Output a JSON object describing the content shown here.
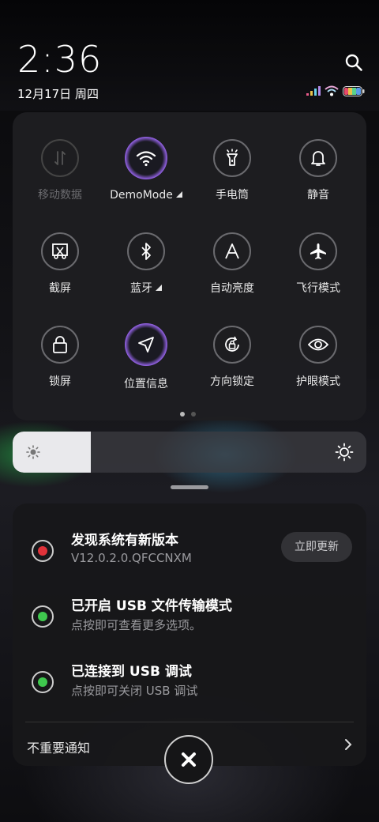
{
  "status": {
    "time": "2:36",
    "date": "12月17日 周四"
  },
  "quick_settings": {
    "tiles": [
      {
        "label": "移动数据",
        "icon": "mobile-data-icon",
        "state": "disabled"
      },
      {
        "label": "DemoMode",
        "icon": "wifi-icon",
        "state": "active",
        "has_menu": true
      },
      {
        "label": "手电筒",
        "icon": "flashlight-icon",
        "state": "off"
      },
      {
        "label": "静音",
        "icon": "bell-icon",
        "state": "off"
      },
      {
        "label": "截屏",
        "icon": "screenshot-icon",
        "state": "off"
      },
      {
        "label": "蓝牙",
        "icon": "bluetooth-icon",
        "state": "off",
        "has_menu": true
      },
      {
        "label": "自动亮度",
        "icon": "auto-brightness-icon",
        "state": "off"
      },
      {
        "label": "飞行模式",
        "icon": "airplane-icon",
        "state": "off"
      },
      {
        "label": "锁屏",
        "icon": "lock-icon",
        "state": "off"
      },
      {
        "label": "位置信息",
        "icon": "location-icon",
        "state": "active"
      },
      {
        "label": "方向锁定",
        "icon": "rotation-lock-icon",
        "state": "off"
      },
      {
        "label": "护眼模式",
        "icon": "eye-icon",
        "state": "off"
      }
    ],
    "page_count": 2,
    "current_page": 1
  },
  "brightness": {
    "level_percent": 22
  },
  "notifications": {
    "items": [
      {
        "title": "发现系统有新版本",
        "body": "V12.0.2.0.QFCCNXM",
        "icon_color": "#e0323a",
        "action": "立即更新"
      },
      {
        "title": "已开启 USB 文件传输模式",
        "body": "点按即可查看更多选项。",
        "icon_color": "#3fc84e"
      },
      {
        "title": "已连接到 USB 调试",
        "body": "点按即可关闭 USB 调试",
        "icon_color": "#3fc84e"
      }
    ],
    "unimportant_label": "不重要通知"
  },
  "colors": {
    "accent_glow": "#a36bff",
    "update_red": "#e0323a",
    "usb_green": "#3fc84e"
  }
}
